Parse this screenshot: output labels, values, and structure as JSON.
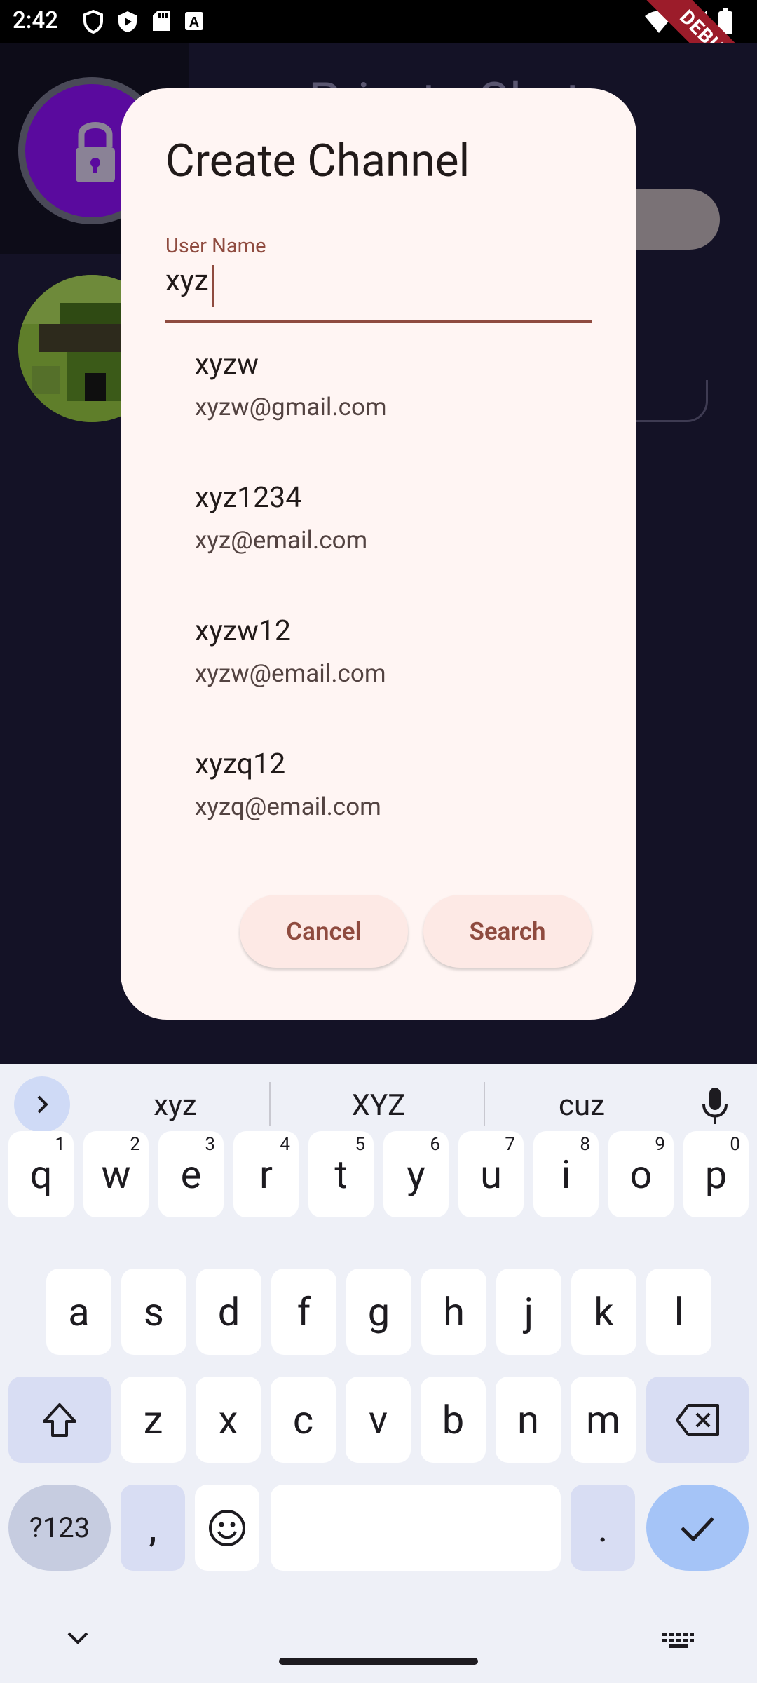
{
  "status_bar": {
    "time": "2:42",
    "debug_banner": "DEBUG"
  },
  "background": {
    "title": "Private Chats"
  },
  "dialog": {
    "title": "Create Channel",
    "field": {
      "label": "User Name",
      "value": "xyz"
    },
    "suggestions": [
      {
        "name": "xyzw",
        "email": "xyzw@gmail.com"
      },
      {
        "name": "xyz1234",
        "email": "xyz@email.com"
      },
      {
        "name": "xyzw12",
        "email": "xyzw@email.com"
      },
      {
        "name": "xyzq12",
        "email": "xyzq@email.com"
      }
    ],
    "buttons": {
      "cancel": "Cancel",
      "search": "Search"
    }
  },
  "keyboard": {
    "suggestions": [
      "xyz",
      "XYZ",
      "cuz"
    ],
    "row1": [
      {
        "k": "q",
        "s": "1"
      },
      {
        "k": "w",
        "s": "2"
      },
      {
        "k": "e",
        "s": "3"
      },
      {
        "k": "r",
        "s": "4"
      },
      {
        "k": "t",
        "s": "5"
      },
      {
        "k": "y",
        "s": "6"
      },
      {
        "k": "u",
        "s": "7"
      },
      {
        "k": "i",
        "s": "8"
      },
      {
        "k": "o",
        "s": "9"
      },
      {
        "k": "p",
        "s": "0"
      }
    ],
    "row2": [
      "a",
      "s",
      "d",
      "f",
      "g",
      "h",
      "j",
      "k",
      "l"
    ],
    "row3": [
      "z",
      "x",
      "c",
      "v",
      "b",
      "n",
      "m"
    ],
    "sym_label": "?123",
    "comma": ",",
    "period": "."
  }
}
